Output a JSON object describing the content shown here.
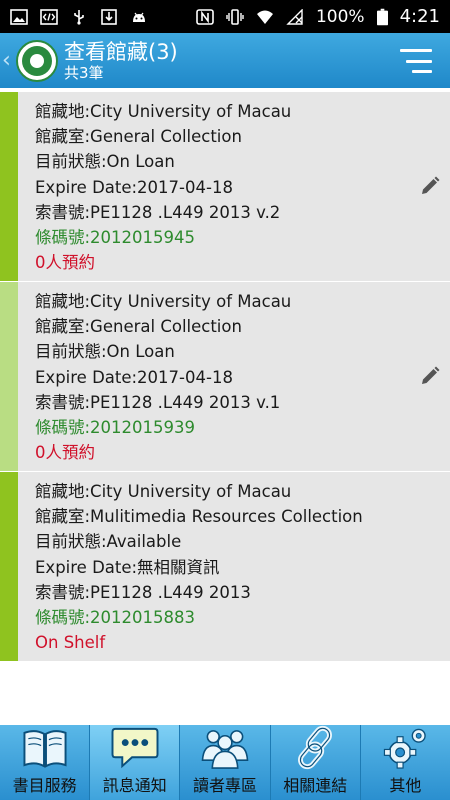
{
  "status_bar": {
    "battery_percent": "100%",
    "time": "4:21"
  },
  "app_bar": {
    "title": "查看館藏(3)",
    "subtitle": "共3筆"
  },
  "holdings": [
    {
      "location": "館藏地:City University of Macau",
      "collection": "館藏室:General Collection",
      "status": "目前狀態:On Loan",
      "expire": "Expire Date:2017-04-18",
      "call_number": "索書號:PE1128 .L449  2013 v.2",
      "barcode": "條碼號:2012015945",
      "reservations": "0人預約",
      "stripe_color": "#8fc31f",
      "editable": true
    },
    {
      "location": "館藏地:City University of Macau",
      "collection": "館藏室:General Collection",
      "status": "目前狀態:On Loan",
      "expire": "Expire Date:2017-04-18",
      "call_number": "索書號:PE1128 .L449  2013 v.1",
      "barcode": "條碼號:2012015939",
      "reservations": "0人預約",
      "stripe_color": "#b9dd83",
      "editable": true
    },
    {
      "location": "館藏地:City University of Macau",
      "collection": "館藏室:Mulitimedia Resources Collection",
      "status": "目前狀態:Available",
      "expire": "Expire Date:無相關資訊",
      "call_number": "索書號:PE1128 .L449  2013",
      "barcode": "條碼號:2012015883",
      "reservations": "On Shelf",
      "stripe_color": "#8fc31f",
      "editable": false
    }
  ],
  "bottom_nav": [
    {
      "label": "書目服務",
      "icon": "book-icon"
    },
    {
      "label": "訊息通知",
      "icon": "chat-icon"
    },
    {
      "label": "讀者專區",
      "icon": "readers-icon"
    },
    {
      "label": "相關連結",
      "icon": "link-icon"
    },
    {
      "label": "其他",
      "icon": "gears-icon"
    }
  ],
  "colors": {
    "accent": "#2a8fcf",
    "barcode": "#2e8b2e",
    "reserve": "#d0112b"
  }
}
